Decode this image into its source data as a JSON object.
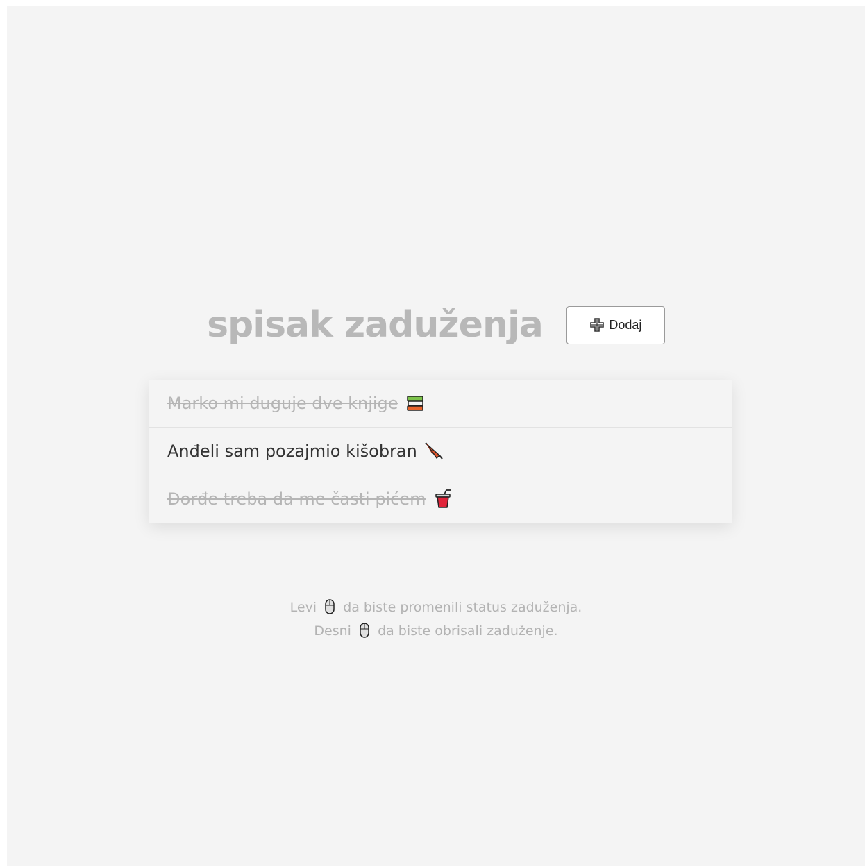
{
  "header": {
    "title": "spisak zaduženja",
    "add_button_label": "Dodaj"
  },
  "items": [
    {
      "text": "Marko mi duguje dve knjige",
      "icon": "books-icon",
      "done": true
    },
    {
      "text": "Anđeli sam pozajmio kišobran",
      "icon": "umbrella-icon",
      "done": false
    },
    {
      "text": "Đorđe treba da me časti pićem",
      "icon": "drink-cup-icon",
      "done": true
    }
  ],
  "hints": {
    "left_prefix": "Levi",
    "left_suffix": "da biste promenili status zaduženja.",
    "right_prefix": "Desni",
    "right_suffix": "da biste obrisali zaduženje."
  },
  "colors": {
    "background": "#f4f4f4",
    "title": "#b8b8b8",
    "text": "#333333",
    "done_text": "#b5b5b5"
  }
}
